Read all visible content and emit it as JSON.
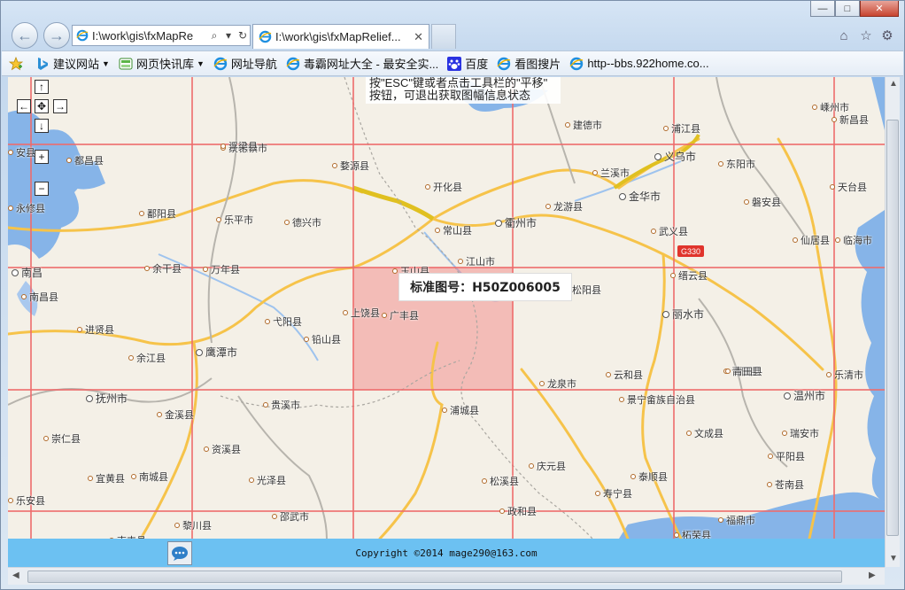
{
  "window": {
    "minimize": "—",
    "maximize": "□",
    "close": "✕"
  },
  "nav": {
    "back": "←",
    "forward": "→"
  },
  "address_bar": {
    "value": "I:\\work\\gis\\fxMapRe",
    "search_glyph": "⌕",
    "dropdown_glyph": "▾",
    "refresh_glyph": "↻"
  },
  "tabs": [
    {
      "label": "I:\\work\\gis\\fxMapRelief...",
      "close": "✕"
    }
  ],
  "toolbar_right": {
    "home": "⌂",
    "favorites": "☆",
    "tools": "⚙"
  },
  "favorites_bar": [
    {
      "label": "",
      "icon": "favorites-star-icon"
    },
    {
      "label": "建议网站",
      "icon": "bing-icon",
      "dropdown": true
    },
    {
      "label": "网页快讯库",
      "icon": "webslice-icon",
      "dropdown": true
    },
    {
      "label": "网址导航",
      "icon": "ie-icon"
    },
    {
      "label": "毒霸网址大全 - 最安全实...",
      "icon": "ie-icon"
    },
    {
      "label": "百度",
      "icon": "baidu-icon"
    },
    {
      "label": "看图搜片",
      "icon": "ie-icon"
    },
    {
      "label": "http--bbs.922home.co...",
      "icon": "ie-icon"
    }
  ],
  "map": {
    "hint_line1": "按\"ESC\"键或者点击工具栏的\"平移\"",
    "hint_line2": "按钮，可退出获取图幅信息状态",
    "sheet_label": "标准图号：H50Z006005",
    "controls": {
      "up": "↑",
      "left": "←",
      "pan": "✥",
      "right": "→",
      "down": "↓",
      "zoom_in": "+",
      "zoom_out": "−"
    },
    "highway_shield": "G330",
    "cities": [
      {
        "name": "景德镇市",
        "major": false
      },
      {
        "name": "婺源县"
      },
      {
        "name": "浮梁县"
      },
      {
        "name": "都昌县"
      },
      {
        "name": "开化县"
      },
      {
        "name": "常山县"
      },
      {
        "name": "衢州市",
        "major": true
      },
      {
        "name": "龙游县"
      },
      {
        "name": "金华市",
        "major": true
      },
      {
        "name": "义乌市",
        "major": true
      },
      {
        "name": "东阳市"
      },
      {
        "name": "浦江县"
      },
      {
        "name": "建德市"
      },
      {
        "name": "兰溪市"
      },
      {
        "name": "磐安县"
      },
      {
        "name": "天台县"
      },
      {
        "name": "仙居县"
      },
      {
        "name": "临海市"
      },
      {
        "name": "武义县"
      },
      {
        "name": "缙云县"
      },
      {
        "name": "丽水市",
        "major": true
      },
      {
        "name": "松阳县"
      },
      {
        "name": "云和县"
      },
      {
        "name": "龙泉市"
      },
      {
        "name": "景宁畲族自治县"
      },
      {
        "name": "青田县"
      },
      {
        "name": "温州市",
        "major": true
      },
      {
        "name": "乐清市"
      },
      {
        "name": "瑞安市"
      },
      {
        "name": "文成县"
      },
      {
        "name": "平阳县"
      },
      {
        "name": "苍南县"
      },
      {
        "name": "泰顺县"
      },
      {
        "name": "庆元县"
      },
      {
        "name": "寿宁县"
      },
      {
        "name": "福鼎市"
      },
      {
        "name": "柘荣县"
      },
      {
        "name": "政和县"
      },
      {
        "name": "松溪县"
      },
      {
        "name": "浦城县"
      },
      {
        "name": "上饶县"
      },
      {
        "name": "广丰县"
      },
      {
        "name": "玉山县"
      },
      {
        "name": "江山市"
      },
      {
        "name": "铅山县"
      },
      {
        "name": "弋阳县"
      },
      {
        "name": "鹰潭市",
        "major": true
      },
      {
        "name": "余江县"
      },
      {
        "name": "贵溪市"
      },
      {
        "name": "万年县"
      },
      {
        "name": "乐平市"
      },
      {
        "name": "德兴市"
      },
      {
        "name": "鄱阳县"
      },
      {
        "name": "余干县"
      },
      {
        "name": "进贤县"
      },
      {
        "name": "南昌县"
      },
      {
        "name": "南昌",
        "major": true
      },
      {
        "name": "抚州市",
        "major": true
      },
      {
        "name": "金溪县"
      },
      {
        "name": "资溪县"
      },
      {
        "name": "光泽县"
      },
      {
        "name": "邵武市"
      },
      {
        "name": "黎川县"
      },
      {
        "name": "南城县"
      },
      {
        "name": "宜黄县"
      },
      {
        "name": "崇仁县"
      },
      {
        "name": "乐安县"
      },
      {
        "name": "南丰县"
      },
      {
        "name": "新昌县"
      },
      {
        "name": "嵊州市"
      },
      {
        "name": "青田县"
      },
      {
        "name": "永修县"
      },
      {
        "name": "安县"
      }
    ]
  },
  "footer": {
    "copyright": "Copyright ©2014 mage290@163.com"
  }
}
